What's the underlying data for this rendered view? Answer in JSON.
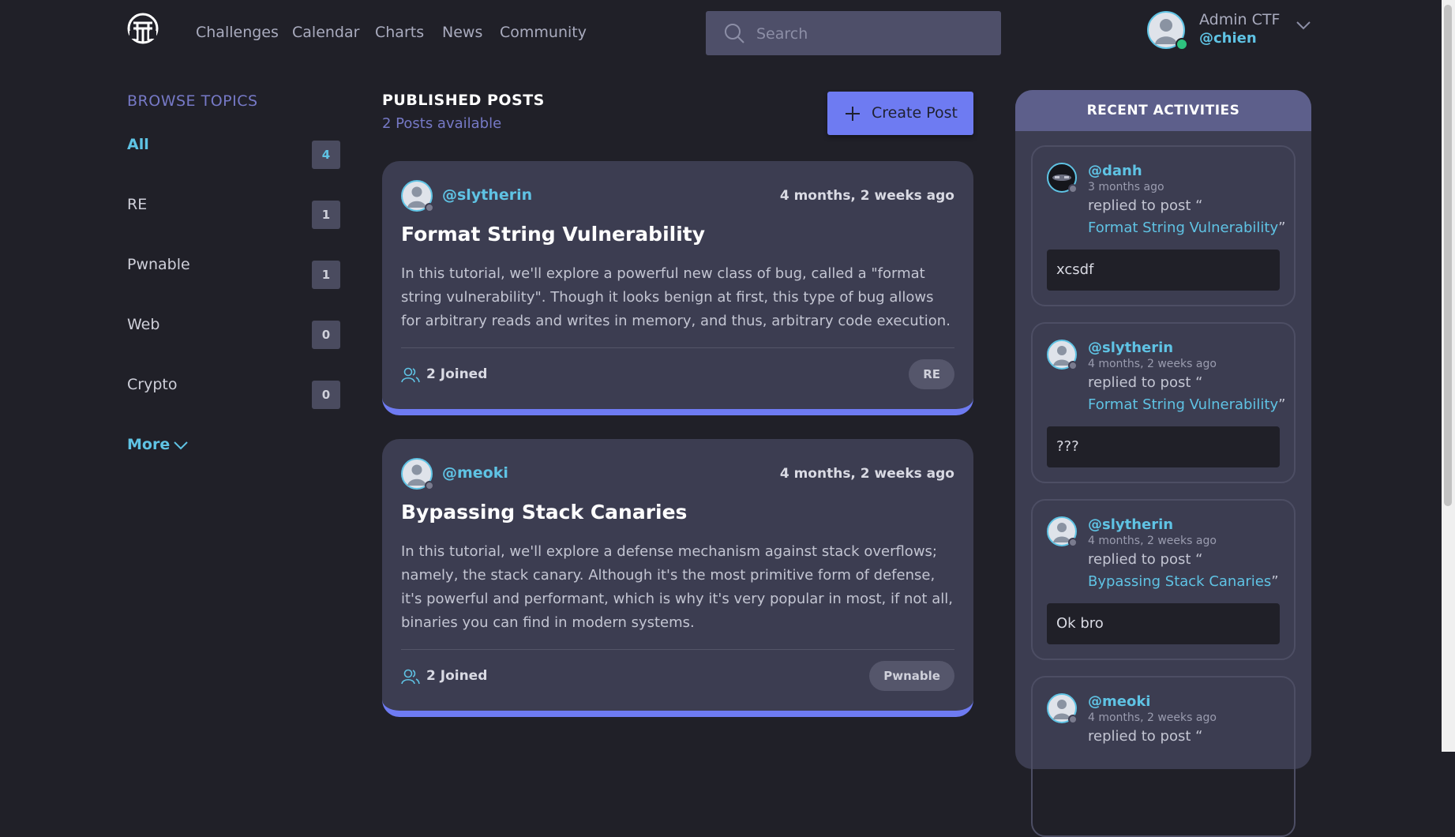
{
  "header": {
    "nav": [
      "Challenges",
      "Calendar",
      "Charts",
      "News",
      "Community"
    ],
    "search_placeholder": "Search",
    "user": {
      "name": "Admin CTF",
      "handle": "@chien",
      "status_color": "#2ec27e"
    }
  },
  "sidebar": {
    "heading": "BROWSE TOPICS",
    "topics": [
      {
        "label": "All",
        "count": "4",
        "active": true
      },
      {
        "label": "RE",
        "count": "1"
      },
      {
        "label": "Pwnable",
        "count": "1"
      },
      {
        "label": "Web",
        "count": "0"
      },
      {
        "label": "Crypto",
        "count": "0"
      }
    ],
    "more": "More"
  },
  "posts": {
    "heading": "PUBLISHED POSTS",
    "count_text": "2 Posts available",
    "create_label": "Create Post",
    "items": [
      {
        "author": "@slytherin",
        "time": "4 months, 2 weeks ago",
        "title": "Format String Vulnerability",
        "body": "In this tutorial, we'll explore a powerful new class of bug, called a \"format string vulnerability\". Though it looks benign at first, this type of bug allows for arbitrary reads and writes in memory, and thus, arbitrary code execution.",
        "joined": "2 Joined",
        "tag": "RE"
      },
      {
        "author": "@meoki",
        "time": "4 months, 2 weeks ago",
        "title": "Bypassing Stack Canaries",
        "body": "In this tutorial, we'll explore a defense mechanism against stack overflows; namely, the stack canary. Although it's the most primitive form of defense, it's powerful and performant, which is why it's very popular in most, if not all, binaries you can find in modern systems.",
        "joined": "2 Joined",
        "tag": "Pwnable"
      }
    ]
  },
  "activities": {
    "heading": "RECENT ACTIVITIES",
    "items": [
      {
        "user": "@danh",
        "time": "3 months ago",
        "action": "replied to post “",
        "post": "Format String Vulnerability",
        "close": "”",
        "message": "xcsdf"
      },
      {
        "user": "@slytherin",
        "time": "4 months, 2 weeks ago",
        "action": "replied to post “",
        "post": "Format String Vulnerability",
        "close": "”",
        "message": "???"
      },
      {
        "user": "@slytherin",
        "time": "4 months, 2 weeks ago",
        "action": "replied to post “",
        "post": "Bypassing Stack Canaries",
        "close": "”",
        "message": "Ok bro"
      },
      {
        "user": "@meoki",
        "time": "4 months, 2 weeks ago",
        "action": "replied to post “"
      }
    ]
  },
  "colors": {
    "accent": "#6e7bf2",
    "link": "#5fc3e4",
    "background": "#202028",
    "card": "#3c3d51"
  }
}
